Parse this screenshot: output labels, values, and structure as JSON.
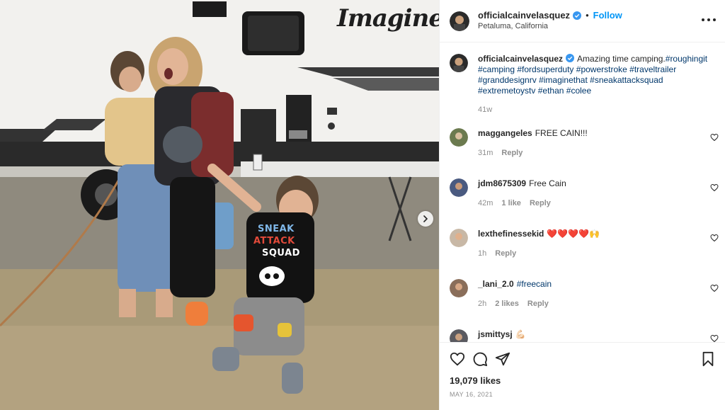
{
  "photo": {
    "brand_text": "Imagine",
    "shirt_lines": [
      "SNEAK",
      "ATTACK",
      "SQUAD"
    ],
    "next_icon": "chevron-right-icon"
  },
  "header": {
    "username": "officialcainvelasquez",
    "verified_icon": "verified-badge-icon",
    "separator": "•",
    "follow_label": "Follow",
    "location": "Petaluma, California",
    "more_icon": "more-options-icon"
  },
  "caption": {
    "username": "officialcainvelasquez",
    "text": "Amazing time camping.",
    "hashtags": [
      "#roughingit",
      "#camping",
      "#fordsuperduty",
      "#powerstroke",
      "#traveltrailer",
      "#granddesignrv",
      "#imaginethat",
      "#sneakattacksquad",
      "#extremetoystv",
      "#ethan",
      "#colee"
    ],
    "time": "41w"
  },
  "comments": [
    {
      "username": "maggangeles",
      "text": "FREE CAIN!!!",
      "time": "31m",
      "likes": "",
      "reply": "Reply"
    },
    {
      "username": "jdm8675309",
      "text": "Free Cain",
      "time": "42m",
      "likes": "1 like",
      "reply": "Reply"
    },
    {
      "username": "lexthefinessekid",
      "text": "❤️❤️❤️❤️🙌",
      "time": "1h",
      "likes": "",
      "reply": "Reply"
    },
    {
      "username": "_lani_2.0",
      "text": "#freecain",
      "time": "2h",
      "likes": "2 likes",
      "reply": "Reply"
    },
    {
      "username": "jsmittysj",
      "text": "💪🏻",
      "time": "",
      "likes": "",
      "reply": ""
    }
  ],
  "actions": {
    "like_icon": "heart-icon",
    "comment_icon": "comment-icon",
    "share_icon": "paper-plane-icon",
    "save_icon": "bookmark-icon"
  },
  "likes_count": "19,079 likes",
  "date": "MAY 16, 2021",
  "colors": {
    "link": "#00376b",
    "follow": "#0095f6",
    "verified": "#3897f0",
    "muted": "#8e8e8e"
  }
}
